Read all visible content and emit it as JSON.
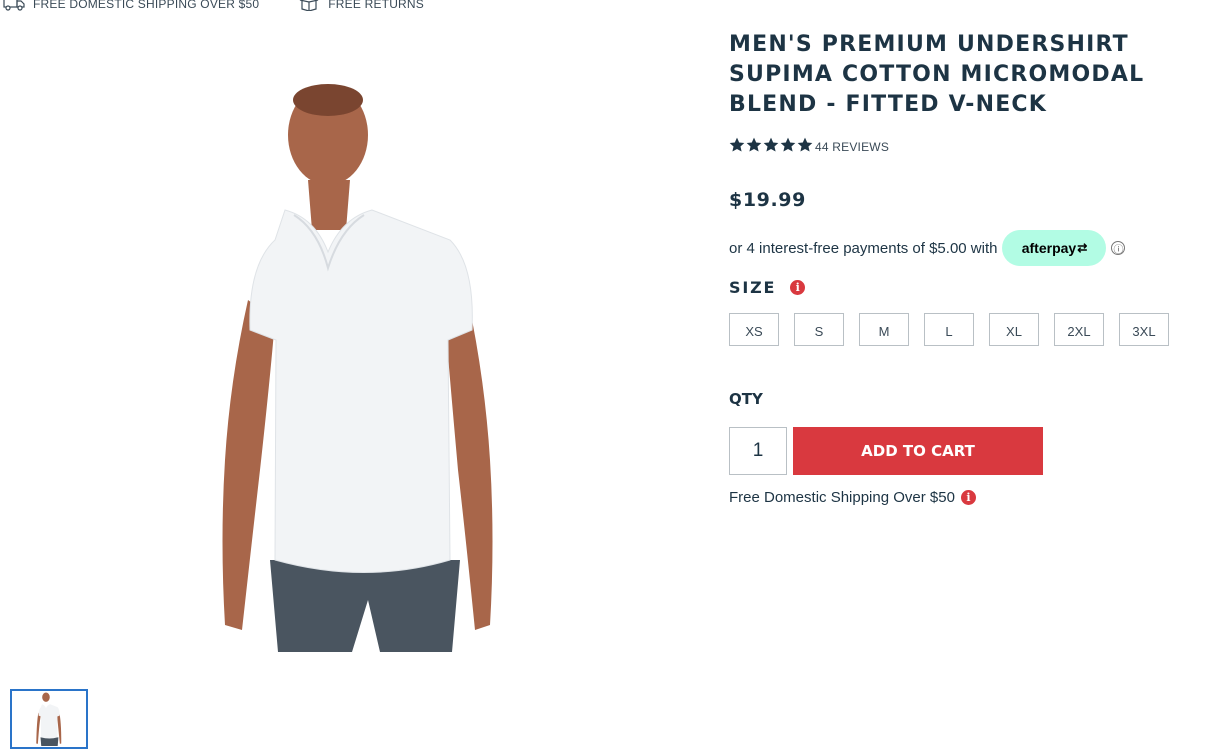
{
  "promo": {
    "shipping": "FREE DOMESTIC SHIPPING OVER $50",
    "returns": "FREE RETURNS",
    "shipping_icon": "truck-icon",
    "returns_icon": "box-icon"
  },
  "product": {
    "title": "MEN'S PREMIUM UNDERSHIRT SUPIMA COTTON MICROMODAL BLEND - FITTED V-NECK",
    "rating": 5,
    "reviews": "44 REVIEWS",
    "price": "$19.99",
    "afterpay_text": "or 4 interest-free payments of $5.00 with",
    "afterpay_logo": "afterpay",
    "afterpay_info": "ⓘ",
    "size_label": "SIZE",
    "sizes": [
      "XS",
      "S",
      "M",
      "L",
      "XL",
      "2XL",
      "3XL"
    ],
    "qty_label": "QTY",
    "qty_value": "1",
    "add_to_cart": "ADD TO CART",
    "shipping_note": "Free Domestic Shipping Over $50"
  },
  "colors": {
    "accent_red": "#d9393f",
    "navy": "#1d3444",
    "afterpay_mint": "#b2fce4"
  }
}
